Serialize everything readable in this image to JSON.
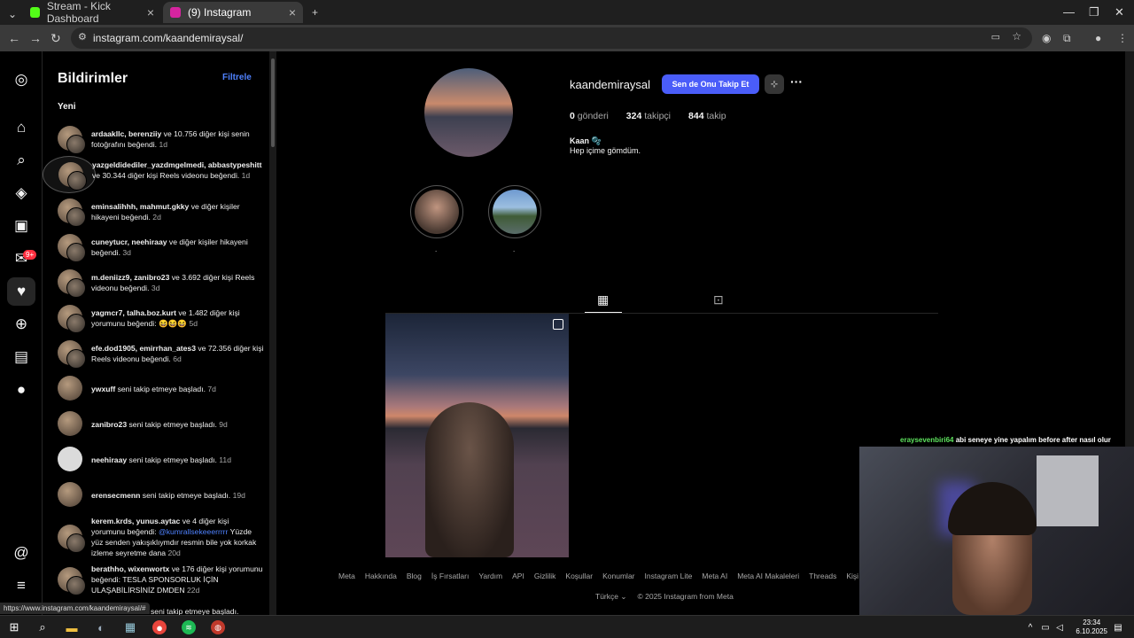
{
  "browser": {
    "tabs": [
      {
        "label": "Stream - Kick Dashboard",
        "favicon_color": "#53fc18"
      },
      {
        "label": "(9) Instagram",
        "favicon_color": "#d6249f"
      }
    ],
    "url": "instagram.com/kaandemiraysal/",
    "status_url": "https://www.instagram.com/kaandemiraysal/#"
  },
  "notifications": {
    "title": "Bildirimler",
    "filter_label": "Filtrele",
    "section_new": "Yeni",
    "items": [
      {
        "users": "ardaakllc, berenziiy",
        "text": " ve 10.756 diğer kişi senin fotoğrafını beğendi.",
        "time": "1d"
      },
      {
        "users": "yazgeldidediler_yazdmgelmedi, abbastypeshitt",
        "text": " ve 30.344 diğer kişi Reels videonu beğendi.",
        "time": "1d"
      },
      {
        "users": "eminsalihhh, mahmut.gkky",
        "text": " ve diğer kişiler hikayeni beğendi.",
        "time": "2d"
      },
      {
        "users": "cuneytucr, neehiraay",
        "text": " ve diğer kişiler hikayeni beğendi.",
        "time": "3d"
      },
      {
        "users": "m.deniizz9, zanibro23",
        "text": " ve 3.692 diğer kişi Reels videonu beğendi.",
        "time": "3d"
      },
      {
        "users": "yagmcr7, talha.boz.kurt",
        "text": " ve 1.482 diğer kişi yorumunu beğendi: 😆😆😆",
        "time": "5d"
      },
      {
        "users": "efe.dod1905, emirrhan_ates3",
        "text": " ve 72.356 diğer kişi Reels videonu beğendi.",
        "time": "6d"
      },
      {
        "users": "ywxuff",
        "text": " seni takip etmeye başladı.",
        "time": "7d"
      },
      {
        "users": "zanibro23",
        "text": " seni takip etmeye başladı.",
        "time": "9d"
      },
      {
        "users": "neehiraay",
        "text": " seni takip etmeye başladı.",
        "time": "11d"
      },
      {
        "users": "erensecmenn",
        "text": " seni takip etmeye başladı.",
        "time": "19d"
      },
      {
        "users": "kerem.krds, yunus.aytac",
        "text": " ve 4 diğer kişi yorumunu beğendi: ",
        "mention": "@kumrallsekeeerrrrr",
        "text2": " Yüzde yüz senden yakışıklıymdır resmin bile yok korkak izleme seyretme dana",
        "time": "20d"
      },
      {
        "users": "berathho, wixenwortx",
        "text": " ve 176 diğer kişi yorumunu beğendi: TESLA SPONSORLUK İÇİN ULAŞABİLİRSİNİZ DMDEN",
        "time": "22d"
      },
      {
        "users": "",
        "text": "seni takip etmeye başladı.",
        "time": ""
      }
    ]
  },
  "profile": {
    "username": "kaandemiraysal",
    "follow_label": "Sen de Onu Takip Et",
    "posts_count": "0",
    "posts_label": "gönderi",
    "followers_count": "324",
    "followers_label": "takipçi",
    "following_count": "844",
    "following_label": "takip",
    "full_name": "Kaan 🫧",
    "bio": "Hep içime gömdüm.",
    "highlights": [
      {
        "label": "."
      },
      {
        "label": "."
      }
    ]
  },
  "footer": {
    "links": [
      "Meta",
      "Hakkında",
      "Blog",
      "İş Fırsatları",
      "Yardım",
      "API",
      "Gizlilik",
      "Koşullar",
      "Konumlar",
      "Instagram Lite",
      "Meta AI",
      "Meta AI Makaleleri",
      "Threads",
      "Kişi Yükleme ve"
    ],
    "language": "Türkçe",
    "copyright": "© 2025 Instagram from Meta"
  },
  "stream_chat": {
    "user": "eraysevenbiri64",
    "message": "abi seneye yine yapalım before after nasıl olur"
  },
  "taskbar": {
    "time": "23:34",
    "date": "6.10.2025"
  }
}
